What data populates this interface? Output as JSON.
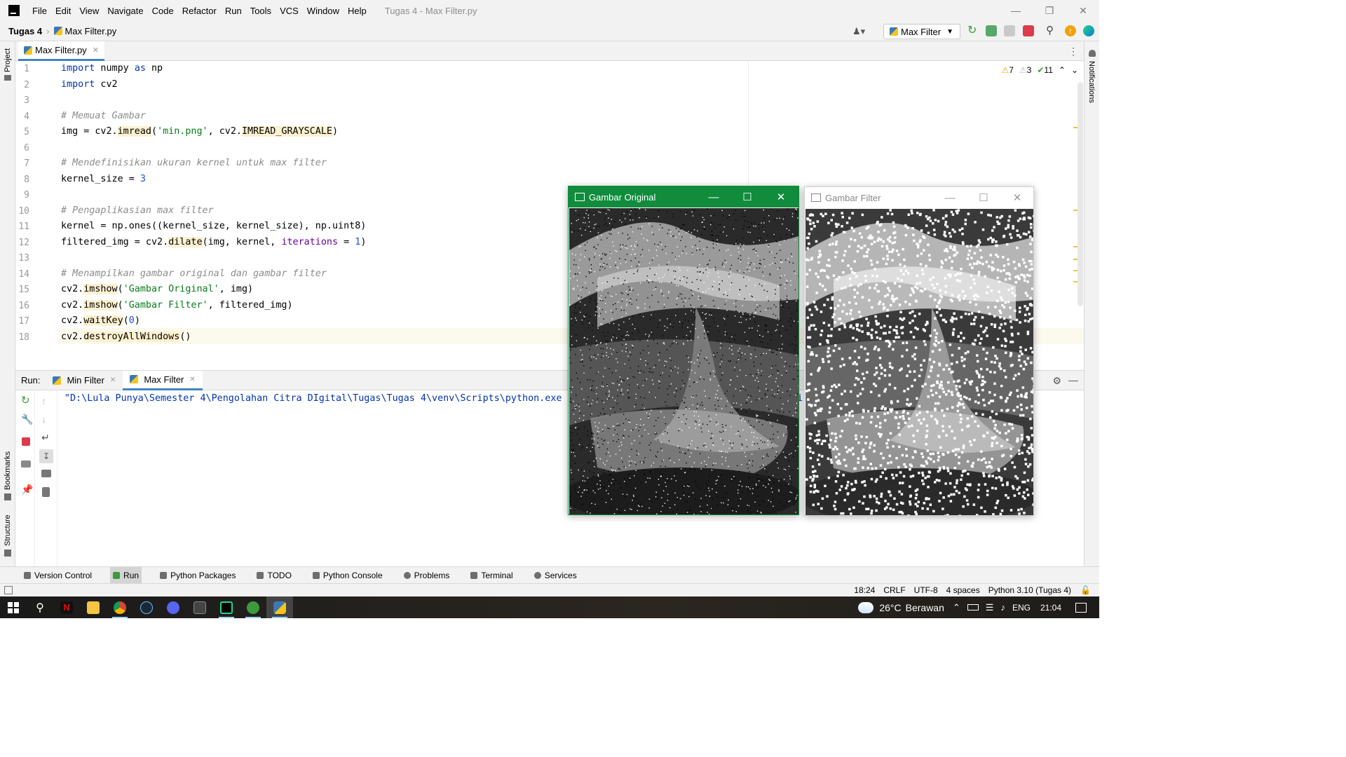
{
  "menubar": {
    "items": [
      "File",
      "Edit",
      "View",
      "Navigate",
      "Code",
      "Refactor",
      "Run",
      "Tools",
      "VCS",
      "Window",
      "Help"
    ],
    "window_title": "Tugas 4 - Max Filter.py",
    "controls": [
      "minimize-icon",
      "restore-icon",
      "close-icon"
    ]
  },
  "navbar": {
    "project": "Tugas 4",
    "file": "Max Filter.py",
    "run_config": "Max Filter"
  },
  "left_stripe": {
    "project": "Project",
    "bookmarks": "Bookmarks",
    "structure": "Structure"
  },
  "right_stripe": {
    "notifications": "Notifications"
  },
  "editor": {
    "tab": "Max Filter.py",
    "inspections": {
      "warnings": "7",
      "weak_warnings": "3",
      "typos": "11"
    },
    "line_numbers": [
      "1",
      "2",
      "3",
      "4",
      "5",
      "6",
      "7",
      "8",
      "9",
      "10",
      "11",
      "12",
      "13",
      "14",
      "15",
      "16",
      "17",
      "18"
    ]
  },
  "run_panel": {
    "label": "Run:",
    "tabs": [
      "Min Filter",
      "Max Filter"
    ],
    "console": "\"D:\\Lula Punya\\Semester 4\\Pengolahan Citra DIgital\\Tugas\\Tugas 4\\venv\\Scripts\\python.exe",
    "console_overflow": "i"
  },
  "bottom_tools": [
    "Version Control",
    "Run",
    "Python Packages",
    "TODO",
    "Python Console",
    "Problems",
    "Terminal",
    "Services"
  ],
  "status_bar": {
    "position": "18:24",
    "line_sep": "CRLF",
    "encoding": "UTF-8",
    "indent": "4 spaces",
    "interpreter": "Python 3.10 (Tugas 4)"
  },
  "cv_windows": {
    "original": {
      "title": "Gambar Original"
    },
    "filter": {
      "title": "Gambar Filter"
    }
  },
  "taskbar": {
    "weather_temp": "26°C",
    "weather_text": "Berawan",
    "lang": "ENG",
    "time": "21:04"
  },
  "colors": {
    "accent": "#4083c9",
    "keyword": "#0033b3",
    "string": "#067d17",
    "comment": "#8c8c8c",
    "cv_active_title": "#108c3c"
  }
}
